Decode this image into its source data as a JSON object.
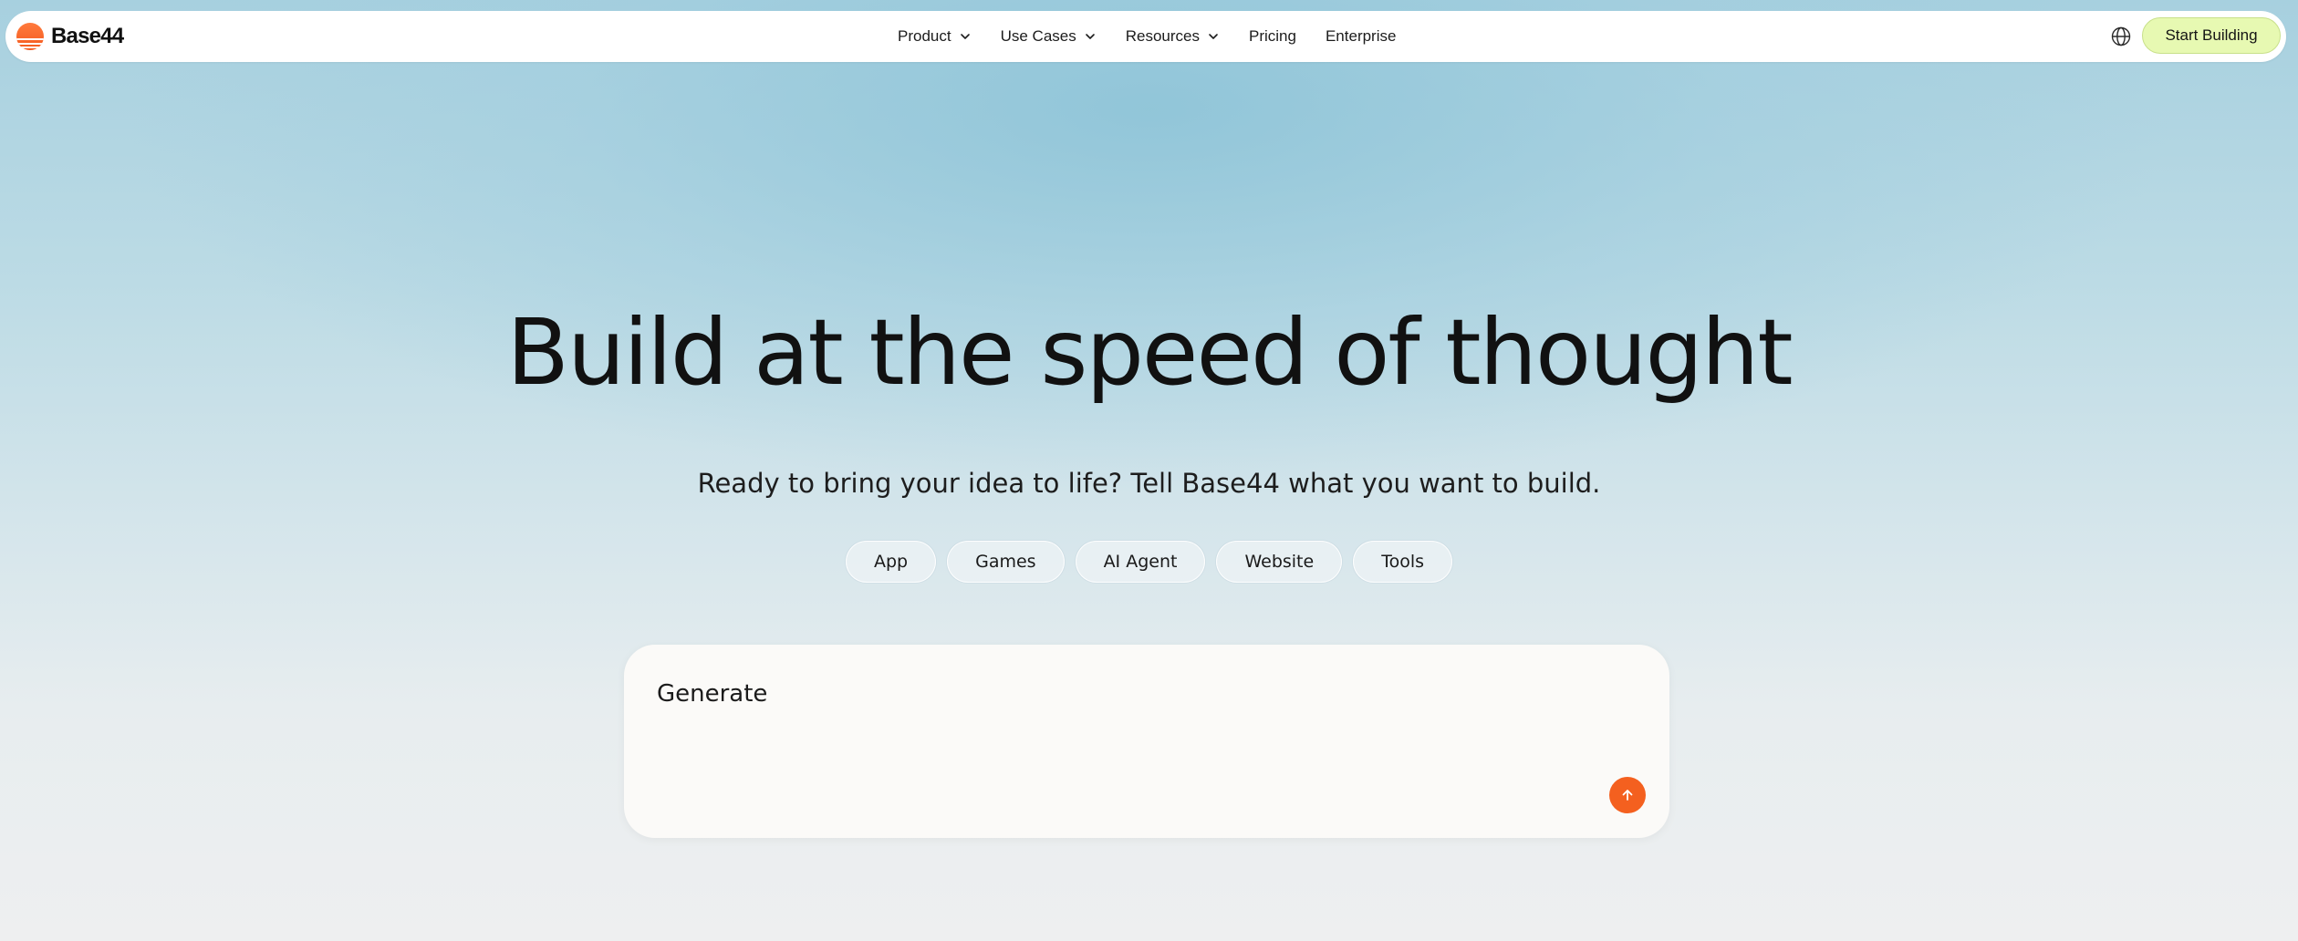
{
  "brand": {
    "name": "Base44",
    "logo_icon": "base44-sun-logo",
    "accent_color": "#f4601f"
  },
  "nav": {
    "items": [
      {
        "label": "Product",
        "has_dropdown": true
      },
      {
        "label": "Use Cases",
        "has_dropdown": true
      },
      {
        "label": "Resources",
        "has_dropdown": true
      },
      {
        "label": "Pricing",
        "has_dropdown": false
      },
      {
        "label": "Enterprise",
        "has_dropdown": false
      }
    ],
    "language_icon": "globe-icon",
    "cta_label": "Start Building",
    "cta_color": "#e7f9b2"
  },
  "hero": {
    "title": "Build at the speed of thought",
    "subtitle": "Ready to bring your idea to life? Tell Base44 what you want to build."
  },
  "categories": [
    "App",
    "Games",
    "AI Agent",
    "Website",
    "Tools"
  ],
  "prompt": {
    "placeholder": "Generate",
    "value": "",
    "send_icon": "arrow-up-icon"
  }
}
